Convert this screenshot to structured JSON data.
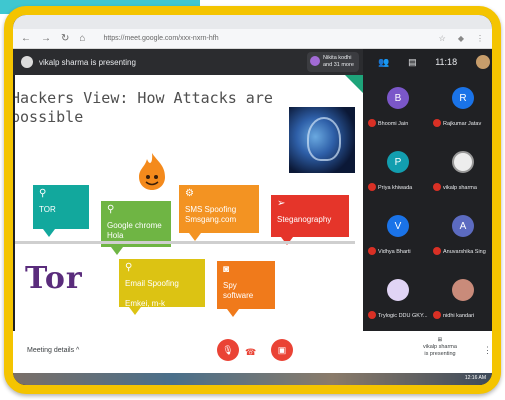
{
  "browser": {
    "url": "https://meet.google.com/xxx-nxrn-hfh"
  },
  "meet": {
    "presenter_text": "vikalp sharma is presenting",
    "presenter_count_name": "Nikita kodhi",
    "presenter_count_more": "and 31 more",
    "time": "11:18",
    "meeting_details": "Meeting details",
    "presenting_label_1": "vikalp sharma",
    "presenting_label_2": "is presenting"
  },
  "slide": {
    "title_line1": "Hackers View: How Attacks are",
    "title_line2": "possible",
    "tor_logo": "Tor",
    "boxes": {
      "tor": "TOR",
      "chrome": "Google chrome Hola",
      "sms_1": "SMS Spoofing",
      "sms_2": "Smsgang.com",
      "stegano": "Steganography",
      "email_1": "Email Spoofing",
      "email_2": "Emkei, m-k",
      "spy": "Spy software"
    }
  },
  "participants": [
    {
      "initial": "B",
      "name": "Bhoomi Jain",
      "color": "#7b57c9"
    },
    {
      "initial": "R",
      "name": "Rajkumar Jatav",
      "color": "#1a73e8"
    },
    {
      "initial": "P",
      "name": "Priya khiwada",
      "color": "#129eaf"
    },
    {
      "initial": "",
      "name": "vikalp sharma",
      "color": "#ededed"
    },
    {
      "initial": "V",
      "name": "Vidhya Bharti",
      "color": "#1a73e8"
    },
    {
      "initial": "A",
      "name": "Anuvarshika Sing",
      "color": "#5c6bc0"
    },
    {
      "initial": "",
      "name": "Trylogic DDU GKY...",
      "color": "#e0d4f5"
    },
    {
      "initial": "",
      "name": "nidhi kandari",
      "color": "#c98b7a"
    }
  ],
  "taskbar": {
    "time": "12:16 AM"
  }
}
